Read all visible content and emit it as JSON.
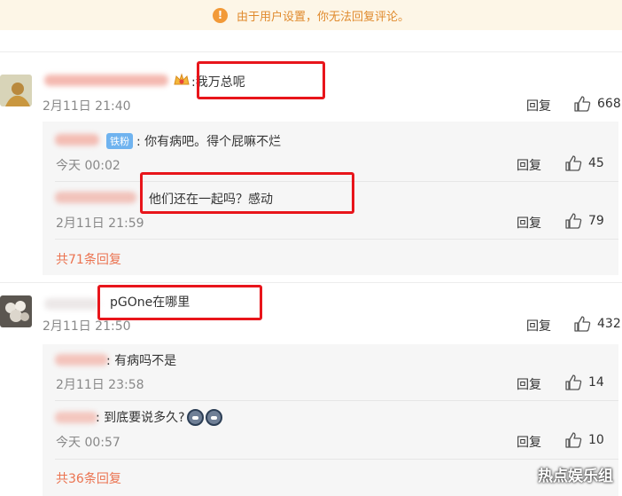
{
  "notice": {
    "icon": "warning-icon",
    "text": "由于用户设置，你无法回复评论。"
  },
  "reply_label": "回复",
  "comments": [
    {
      "text": ":我万总呢",
      "time": "2月11日 21:40",
      "likes": "668",
      "replies": [
        {
          "badge": "铁粉",
          "text": ": 你有病吧。得个屁嘛不烂",
          "time": "今天 00:02",
          "likes": "45"
        },
        {
          "text": "他们还在一起吗？感动",
          "time": "2月11日 21:59",
          "likes": "79"
        }
      ],
      "more": "共71条回复"
    },
    {
      "text": "pGOne在哪里",
      "time": "2月11日 21:50",
      "likes": "432",
      "replies": [
        {
          "text": ": 有病吗不是",
          "time": "2月11日 23:58",
          "likes": "14"
        },
        {
          "text": ": 到底要说多久?",
          "time": "今天 00:57",
          "likes": "10"
        }
      ],
      "more": "共36条回复"
    }
  ],
  "watermark": "热点娱乐组",
  "colors": {
    "notice_bg": "#fdf6e7",
    "notice_text": "#e08a2d",
    "link": "#eb7350",
    "highlight_box": "#e8151b",
    "fan_badge": "#6fb3ef"
  }
}
